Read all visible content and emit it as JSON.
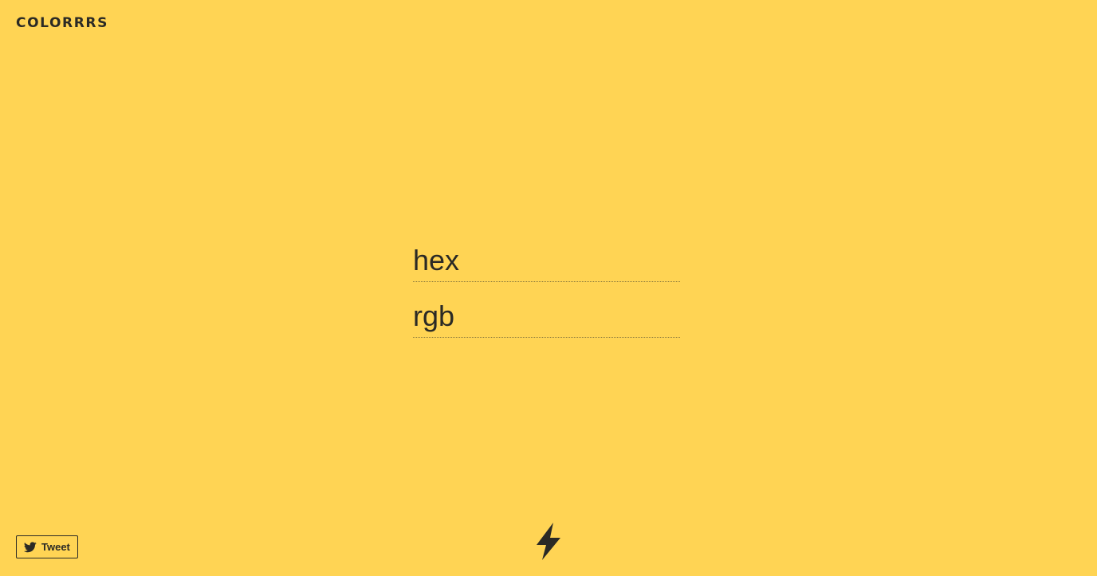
{
  "brand": {
    "title": "COLORRRS"
  },
  "form": {
    "hex": {
      "placeholder": "hex",
      "value": ""
    },
    "rgb": {
      "placeholder": "rgb",
      "value": ""
    }
  },
  "footer": {
    "tweet_label": "Tweet",
    "tweet_icon": "twitter-bird-icon",
    "bolt_icon": "lightning-bolt-icon"
  },
  "colors": {
    "background": "#FFD454",
    "foreground": "#2B2A25"
  }
}
